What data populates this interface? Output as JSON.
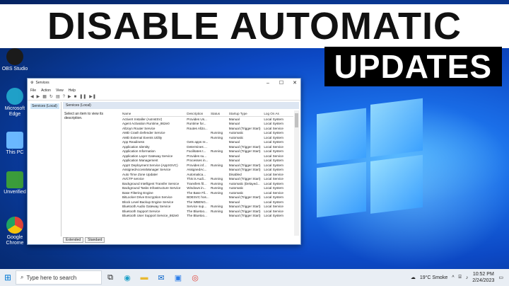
{
  "thumbnail": {
    "title_line1": "DISABLE AUTOMATIC",
    "title_line2": "UPDATES"
  },
  "desktop_icons": [
    {
      "label": "OBS Studio",
      "icon": "obs-icon",
      "color": "#1b1b1b"
    },
    {
      "label": "Microsoft Edge",
      "icon": "edge-icon",
      "color": "#1fa0c8"
    },
    {
      "label": "This PC",
      "icon": "computer-icon",
      "color": "#6ab7ff"
    },
    {
      "label": "Unverified",
      "icon": "app-grid-icon",
      "color": "#3b9c3b"
    },
    {
      "label": "Google Chrome",
      "icon": "chrome-icon",
      "color": "#e0443a"
    }
  ],
  "window": {
    "title": "Services",
    "menu": [
      "File",
      "Action",
      "View",
      "Help"
    ],
    "tree_item": "Services (Local)",
    "panel_header": "Services (Local)",
    "description_hint": "Select an item to view its description.",
    "columns": [
      "Name",
      "Description",
      "Status",
      "Startup Type",
      "Log On As"
    ],
    "rows": [
      [
        "ActiveX Installer (AxInstSV)",
        "Provides Us...",
        "",
        "Manual",
        "Local System"
      ],
      [
        "Agent Activation Runtime_862e0",
        "Runtime for...",
        "",
        "Manual",
        "Local System"
      ],
      [
        "AllJoyn Router Service",
        "Routes AllJo...",
        "",
        "Manual (Trigger Start)",
        "Local Service"
      ],
      [
        "AMD Crash Defender Service",
        "",
        "Running",
        "Automatic",
        "Local System"
      ],
      [
        "AMD External Events Utility",
        "",
        "Running",
        "Automatic",
        "Local System"
      ],
      [
        "App Readiness",
        "Gets apps re...",
        "",
        "Manual",
        "Local System"
      ],
      [
        "Application Identity",
        "Determines ...",
        "",
        "Manual (Trigger Start)",
        "Local Service"
      ],
      [
        "Application Information",
        "Facilitates t...",
        "Running",
        "Manual (Trigger Start)",
        "Local System"
      ],
      [
        "Application Layer Gateway Service",
        "Provides su...",
        "",
        "Manual",
        "Local Service"
      ],
      [
        "Application Management",
        "Processes in...",
        "",
        "Manual",
        "Local System"
      ],
      [
        "AppX Deployment Service (AppXSVC)",
        "Provides inf...",
        "Running",
        "Manual (Trigger Start)",
        "Local System"
      ],
      [
        "AssignedAccessManager Service",
        "AssignedAc...",
        "",
        "Manual (Trigger Start)",
        "Local System"
      ],
      [
        "Auto Time Zone Updater",
        "Automatica...",
        "",
        "Disabled",
        "Local Service"
      ],
      [
        "AVCTP service",
        "This is Audi...",
        "Running",
        "Manual (Trigger Start)",
        "Local Service"
      ],
      [
        "Background Intelligent Transfer Service",
        "Transfers fil...",
        "Running",
        "Automatic (Delayed...",
        "Local System"
      ],
      [
        "Background Tasks Infrastructure Service",
        "Windows in...",
        "Running",
        "Automatic",
        "Local System"
      ],
      [
        "Base Filtering Engine",
        "The Base Fil...",
        "Running",
        "Automatic",
        "Local Service"
      ],
      [
        "BitLocker Drive Encryption Service",
        "BDESVC hos...",
        "",
        "Manual (Trigger Start)",
        "Local System"
      ],
      [
        "Block Level Backup Engine Service",
        "The WBENG...",
        "",
        "Manual",
        "Local System"
      ],
      [
        "Bluetooth Audio Gateway Service",
        "Service sup...",
        "Running",
        "Manual (Trigger Start)",
        "Local Service"
      ],
      [
        "Bluetooth Support Service",
        "The Bluetoo...",
        "Running",
        "Manual (Trigger Start)",
        "Local Service"
      ],
      [
        "Bluetooth User Support Service_862e0",
        "The Bluetoo...",
        "",
        "Manual (Trigger Start)",
        "Local System"
      ]
    ],
    "tabs": [
      "Extended",
      "Standard"
    ]
  },
  "taskbar": {
    "search_placeholder": "Type here to search",
    "weather": "19°C Smoke",
    "time": "10:52 PM",
    "date": "2/24/2023",
    "apps": [
      "task-view-icon",
      "edge-icon",
      "folder-icon",
      "mail-icon",
      "store-icon",
      "chrome-icon"
    ]
  }
}
